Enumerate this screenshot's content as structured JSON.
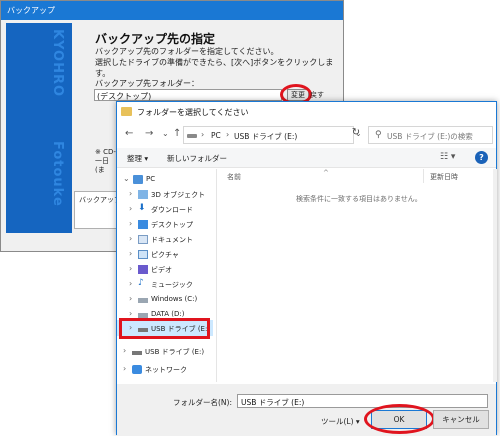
{
  "wizard": {
    "title": "バックアップ",
    "banner_text_1": "KYOHRO",
    "banner_text_2": "Fotouke",
    "heading": "バックアップ先の指定",
    "desc_line1": "バックアップ先のフォルダーを指定してください。",
    "desc_line2": "選択したドライブの準備ができたら、[次へ]ボタンをクリックします。",
    "folder_label": "バックアップ先フォルダー：",
    "folder_value": "(デスクトップ)",
    "change_button": "変更",
    "back_button": "戻す",
    "note_line1": "※ CD-",
    "note_line2": "一日",
    "note_line3": "(ま",
    "group_label": "バックアップ"
  },
  "dialog": {
    "title": "フォルダーを選択してください",
    "nav": {
      "back": "←",
      "forward": "→",
      "recent": "⌄",
      "up": "↑"
    },
    "address": {
      "sep": "›",
      "pc": "PC",
      "drive": "USB ドライブ (E:)",
      "dropdown": "⌄",
      "refresh": "↻"
    },
    "search_placeholder": "USB ドライブ (E:)の検索",
    "toolbar": {
      "organize": "整理 ▾",
      "new_folder": "新しいフォルダー",
      "view": "☷ ▾",
      "help": "?"
    },
    "tree": {
      "items": [
        {
          "label": "PC",
          "chevron": "⌄"
        },
        {
          "label": "3D オブジェクト",
          "chevron": "›"
        },
        {
          "label": "ダウンロード",
          "chevron": "›"
        },
        {
          "label": "デスクトップ",
          "chevron": "›"
        },
        {
          "label": "ドキュメント",
          "chevron": "›"
        },
        {
          "label": "ピクチャ",
          "chevron": "›"
        },
        {
          "label": "ビデオ",
          "chevron": "›"
        },
        {
          "label": "ミュージック",
          "chevron": "›"
        },
        {
          "label": "Windows (C:)",
          "chevron": "›"
        },
        {
          "label": "DATA (D:)",
          "chevron": "›"
        },
        {
          "label": "USB ドライブ (E:)",
          "chevron": "›"
        },
        {
          "label": "USB ドライブ (E:)",
          "chevron": "›"
        },
        {
          "label": "ネットワーク",
          "chevron": "›"
        }
      ],
      "scroll_left": "‹",
      "scroll_right": "›"
    },
    "content": {
      "col_name": "名前",
      "col_date": "更新日時",
      "sort_indicator": "^",
      "empty_message": "検索条件に一致する項目はありません。"
    },
    "bottom": {
      "folder_name_label": "フォルダー名(N):",
      "folder_name_value": "USB ドライブ (E:)",
      "tool_button": "ツール(L) ▾",
      "ok_button": "OK",
      "cancel_button": "キャンセル"
    }
  }
}
